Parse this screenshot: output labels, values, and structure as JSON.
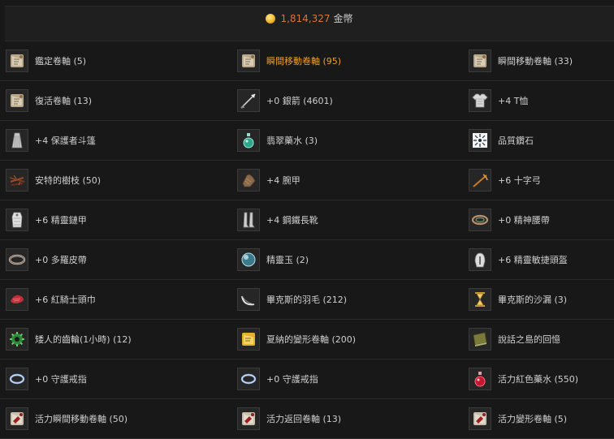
{
  "currency": {
    "amount": "1,814,327",
    "unit": "金幣",
    "icon": "gold-coin-icon"
  },
  "rows": [
    [
      {
        "label": "鑑定卷軸 (5)",
        "icon": "scroll-icon"
      },
      {
        "label": "瞬間移動卷軸 (95)",
        "icon": "scroll-icon",
        "highlight": true
      },
      {
        "label": "瞬間移動卷軸 (33)",
        "icon": "scroll-icon"
      }
    ],
    [
      {
        "label": "復活卷軸 (13)",
        "icon": "scroll-icon"
      },
      {
        "label": "+0 銀箭 (4601)",
        "icon": "silver-arrow-icon"
      },
      {
        "label": "+4 T恤",
        "icon": "tshirt-icon"
      }
    ],
    [
      {
        "label": "+4 保護者斗篷",
        "icon": "cloak-icon"
      },
      {
        "label": "翡翠藥水 (3)",
        "icon": "green-potion-icon"
      },
      {
        "label": "品質鑽石",
        "icon": "diamond-icon"
      }
    ],
    [
      {
        "label": "安特的樹枝 (50)",
        "icon": "branch-icon"
      },
      {
        "label": "+4 腕甲",
        "icon": "gauntlet-icon"
      },
      {
        "label": "+6 十字弓",
        "icon": "crossbow-icon"
      }
    ],
    [
      {
        "label": "+6 精靈鏈甲",
        "icon": "chainmail-icon"
      },
      {
        "label": "+4 鋼鐵長靴",
        "icon": "boots-icon"
      },
      {
        "label": "+0 精神腰帶",
        "icon": "belt-icon"
      }
    ],
    [
      {
        "label": "+0 多羅皮帶",
        "icon": "belt-ring-icon"
      },
      {
        "label": "精靈玉 (2)",
        "icon": "orb-icon"
      },
      {
        "label": "+6 精靈敏捷頭盔",
        "icon": "helmet-icon"
      }
    ],
    [
      {
        "label": "+6 紅騎士頭巾",
        "icon": "red-bandana-icon"
      },
      {
        "label": "畢克斯的羽毛 (212)",
        "icon": "feather-icon"
      },
      {
        "label": "畢克斯的沙漏 (3)",
        "icon": "hourglass-icon"
      }
    ],
    [
      {
        "label": "矮人的齒輪(1小時) (12)",
        "icon": "gear-icon"
      },
      {
        "label": "夏納的變形卷軸 (200)",
        "icon": "gold-scroll-icon"
      },
      {
        "label": "說話之島的回憶",
        "icon": "book-icon"
      }
    ],
    [
      {
        "label": "+0 守護戒指",
        "icon": "ring-icon"
      },
      {
        "label": "+0 守護戒指",
        "icon": "ring-icon"
      },
      {
        "label": "活力紅色藥水 (550)",
        "icon": "red-potion-icon"
      }
    ],
    [
      {
        "label": "活力瞬間移動卷軸 (50)",
        "icon": "scroll-red-icon"
      },
      {
        "label": "活力返回卷軸 (13)",
        "icon": "scroll-red-icon"
      },
      {
        "label": "活力變形卷軸 (5)",
        "icon": "scroll-red-icon"
      }
    ]
  ]
}
